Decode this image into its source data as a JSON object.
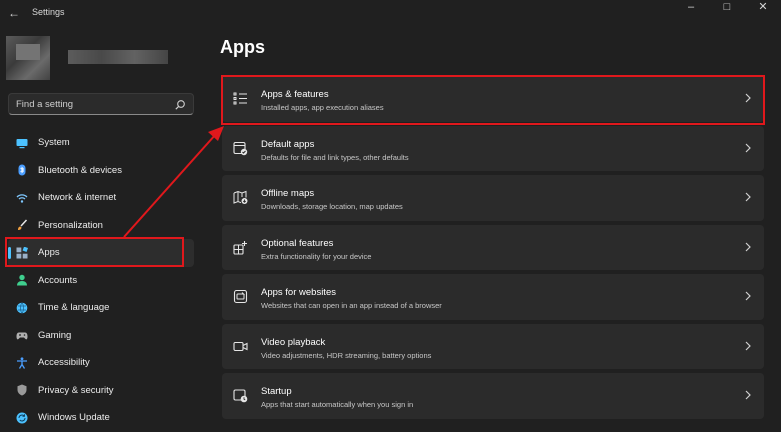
{
  "window": {
    "title": "Settings",
    "back_icon": "back-arrow-icon",
    "controls": [
      "minimize",
      "maximize",
      "close"
    ]
  },
  "search": {
    "placeholder": "Find a setting"
  },
  "sidebar": {
    "items": [
      {
        "label": "System",
        "icon": "system-icon",
        "color": "#4cc2ff"
      },
      {
        "label": "Bluetooth & devices",
        "icon": "bluetooth-icon",
        "color": "#4a9eff"
      },
      {
        "label": "Network & internet",
        "icon": "wifi-icon",
        "color": "#7fc8ff"
      },
      {
        "label": "Personalization",
        "icon": "brush-icon",
        "color": "#f0a040"
      },
      {
        "label": "Apps",
        "icon": "apps-icon",
        "color": "#9ab0c8",
        "selected": true
      },
      {
        "label": "Accounts",
        "icon": "person-icon",
        "color": "#3fcf8e"
      },
      {
        "label": "Time & language",
        "icon": "globe-icon",
        "color": "#4cc2ff"
      },
      {
        "label": "Gaming",
        "icon": "gamepad-icon",
        "color": "#b0b0b0"
      },
      {
        "label": "Accessibility",
        "icon": "accessibility-icon",
        "color": "#4a9eff"
      },
      {
        "label": "Privacy & security",
        "icon": "shield-icon",
        "color": "#9a9a9a"
      },
      {
        "label": "Windows Update",
        "icon": "update-icon",
        "color": "#4cc2ff"
      }
    ]
  },
  "main": {
    "title": "Apps",
    "cards": [
      {
        "title": "Apps & features",
        "desc": "Installed apps, app execution aliases",
        "icon": "list-icon"
      },
      {
        "title": "Default apps",
        "desc": "Defaults for file and link types, other defaults",
        "icon": "default-apps-icon"
      },
      {
        "title": "Offline maps",
        "desc": "Downloads, storage location, map updates",
        "icon": "map-icon"
      },
      {
        "title": "Optional features",
        "desc": "Extra functionality for your device",
        "icon": "optional-features-icon"
      },
      {
        "title": "Apps for websites",
        "desc": "Websites that can open in an app instead of a browser",
        "icon": "website-app-icon"
      },
      {
        "title": "Video playback",
        "desc": "Video adjustments, HDR streaming, battery options",
        "icon": "video-icon"
      },
      {
        "title": "Startup",
        "desc": "Apps that start automatically when you sign in",
        "icon": "startup-icon"
      }
    ]
  },
  "annotations": {
    "highlight_color": "#e0181c"
  }
}
